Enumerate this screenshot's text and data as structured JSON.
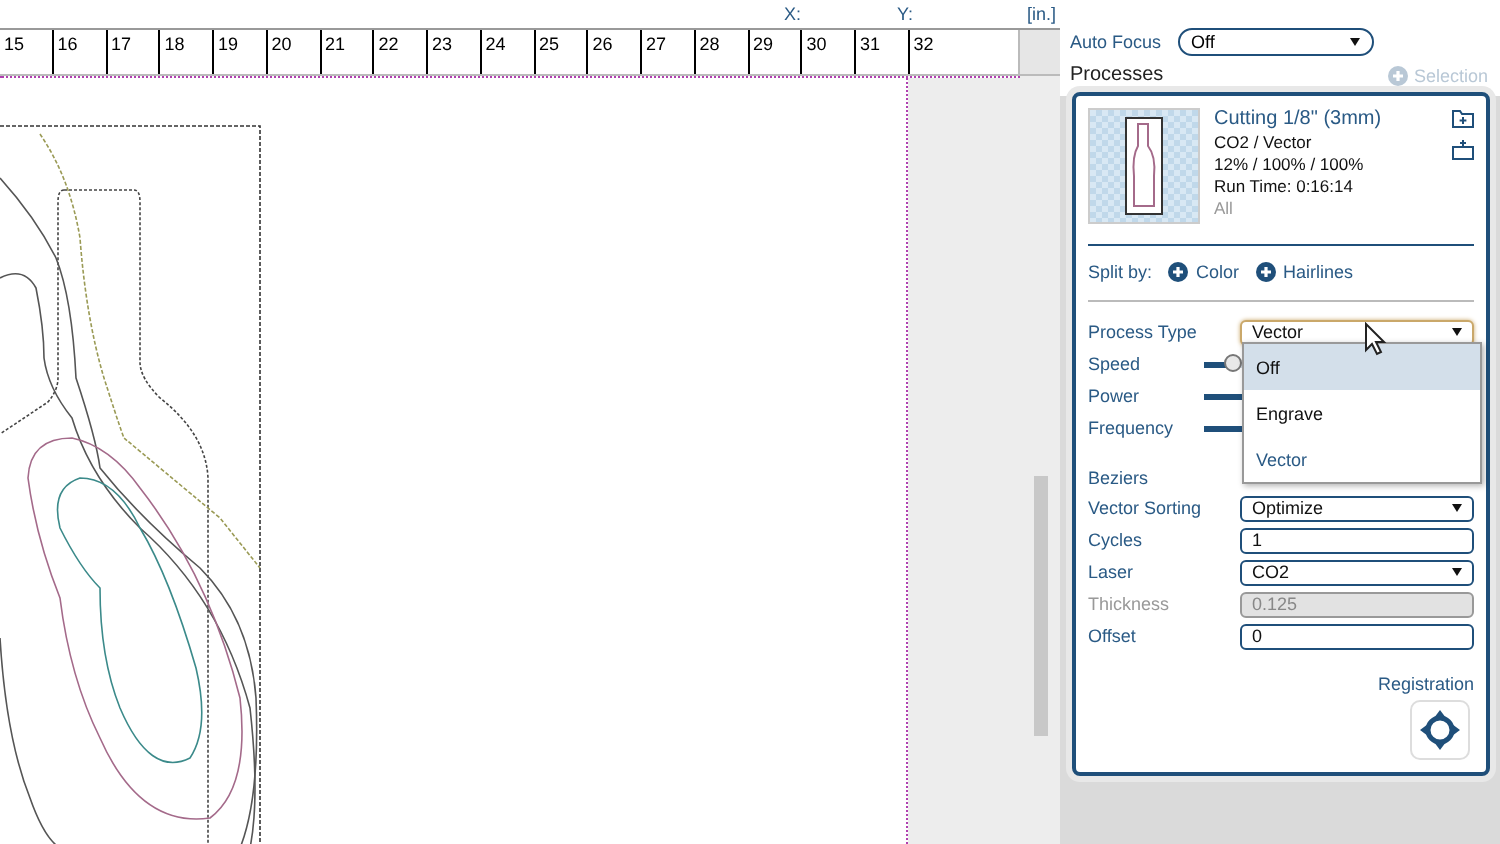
{
  "coords": {
    "x_label": "X:",
    "y_label": "Y:",
    "unit": "[in.]"
  },
  "ruler": {
    "labels": [
      "15",
      "16",
      "17",
      "18",
      "19",
      "20",
      "21",
      "22",
      "23",
      "24",
      "25",
      "26",
      "27",
      "28",
      "29",
      "30",
      "31",
      "32"
    ]
  },
  "auto_focus": {
    "label": "Auto Focus",
    "value": "Off"
  },
  "processes": {
    "title": "Processes",
    "add_label": "Selection",
    "card": {
      "name": "Cutting 1/8\" (3mm)",
      "type": "CO2 / Vector",
      "settings": "12% / 100% / 100%",
      "run_time": "Run Time: 0:16:14",
      "scope": "All"
    },
    "split": {
      "label": "Split by:",
      "options": [
        "Color",
        "Hairlines"
      ]
    },
    "process_type": {
      "label": "Process Type",
      "value": "Vector",
      "options": [
        {
          "label": "Off",
          "highlighted": true,
          "selected": false
        },
        {
          "label": "Engrave",
          "highlighted": false,
          "selected": false
        },
        {
          "label": "Vector",
          "highlighted": false,
          "selected": true
        }
      ]
    },
    "sliders": [
      {
        "label": "Speed",
        "level": 0.15
      },
      {
        "label": "Power",
        "level": 1
      },
      {
        "label": "Frequency",
        "level": 1
      }
    ],
    "beziers": {
      "label": "Beziers"
    },
    "fields": [
      {
        "label": "Vector Sorting",
        "kind": "select",
        "value": "Optimize",
        "disabled": false
      },
      {
        "label": "Cycles",
        "kind": "text",
        "value": "1",
        "disabled": false
      },
      {
        "label": "Laser",
        "kind": "select",
        "value": "CO2",
        "disabled": false
      },
      {
        "label": "Thickness",
        "kind": "text",
        "value": "0.125",
        "disabled": true
      },
      {
        "label": "Offset",
        "kind": "text",
        "value": "0",
        "disabled": false
      }
    ],
    "registration": {
      "label": "Registration"
    }
  }
}
